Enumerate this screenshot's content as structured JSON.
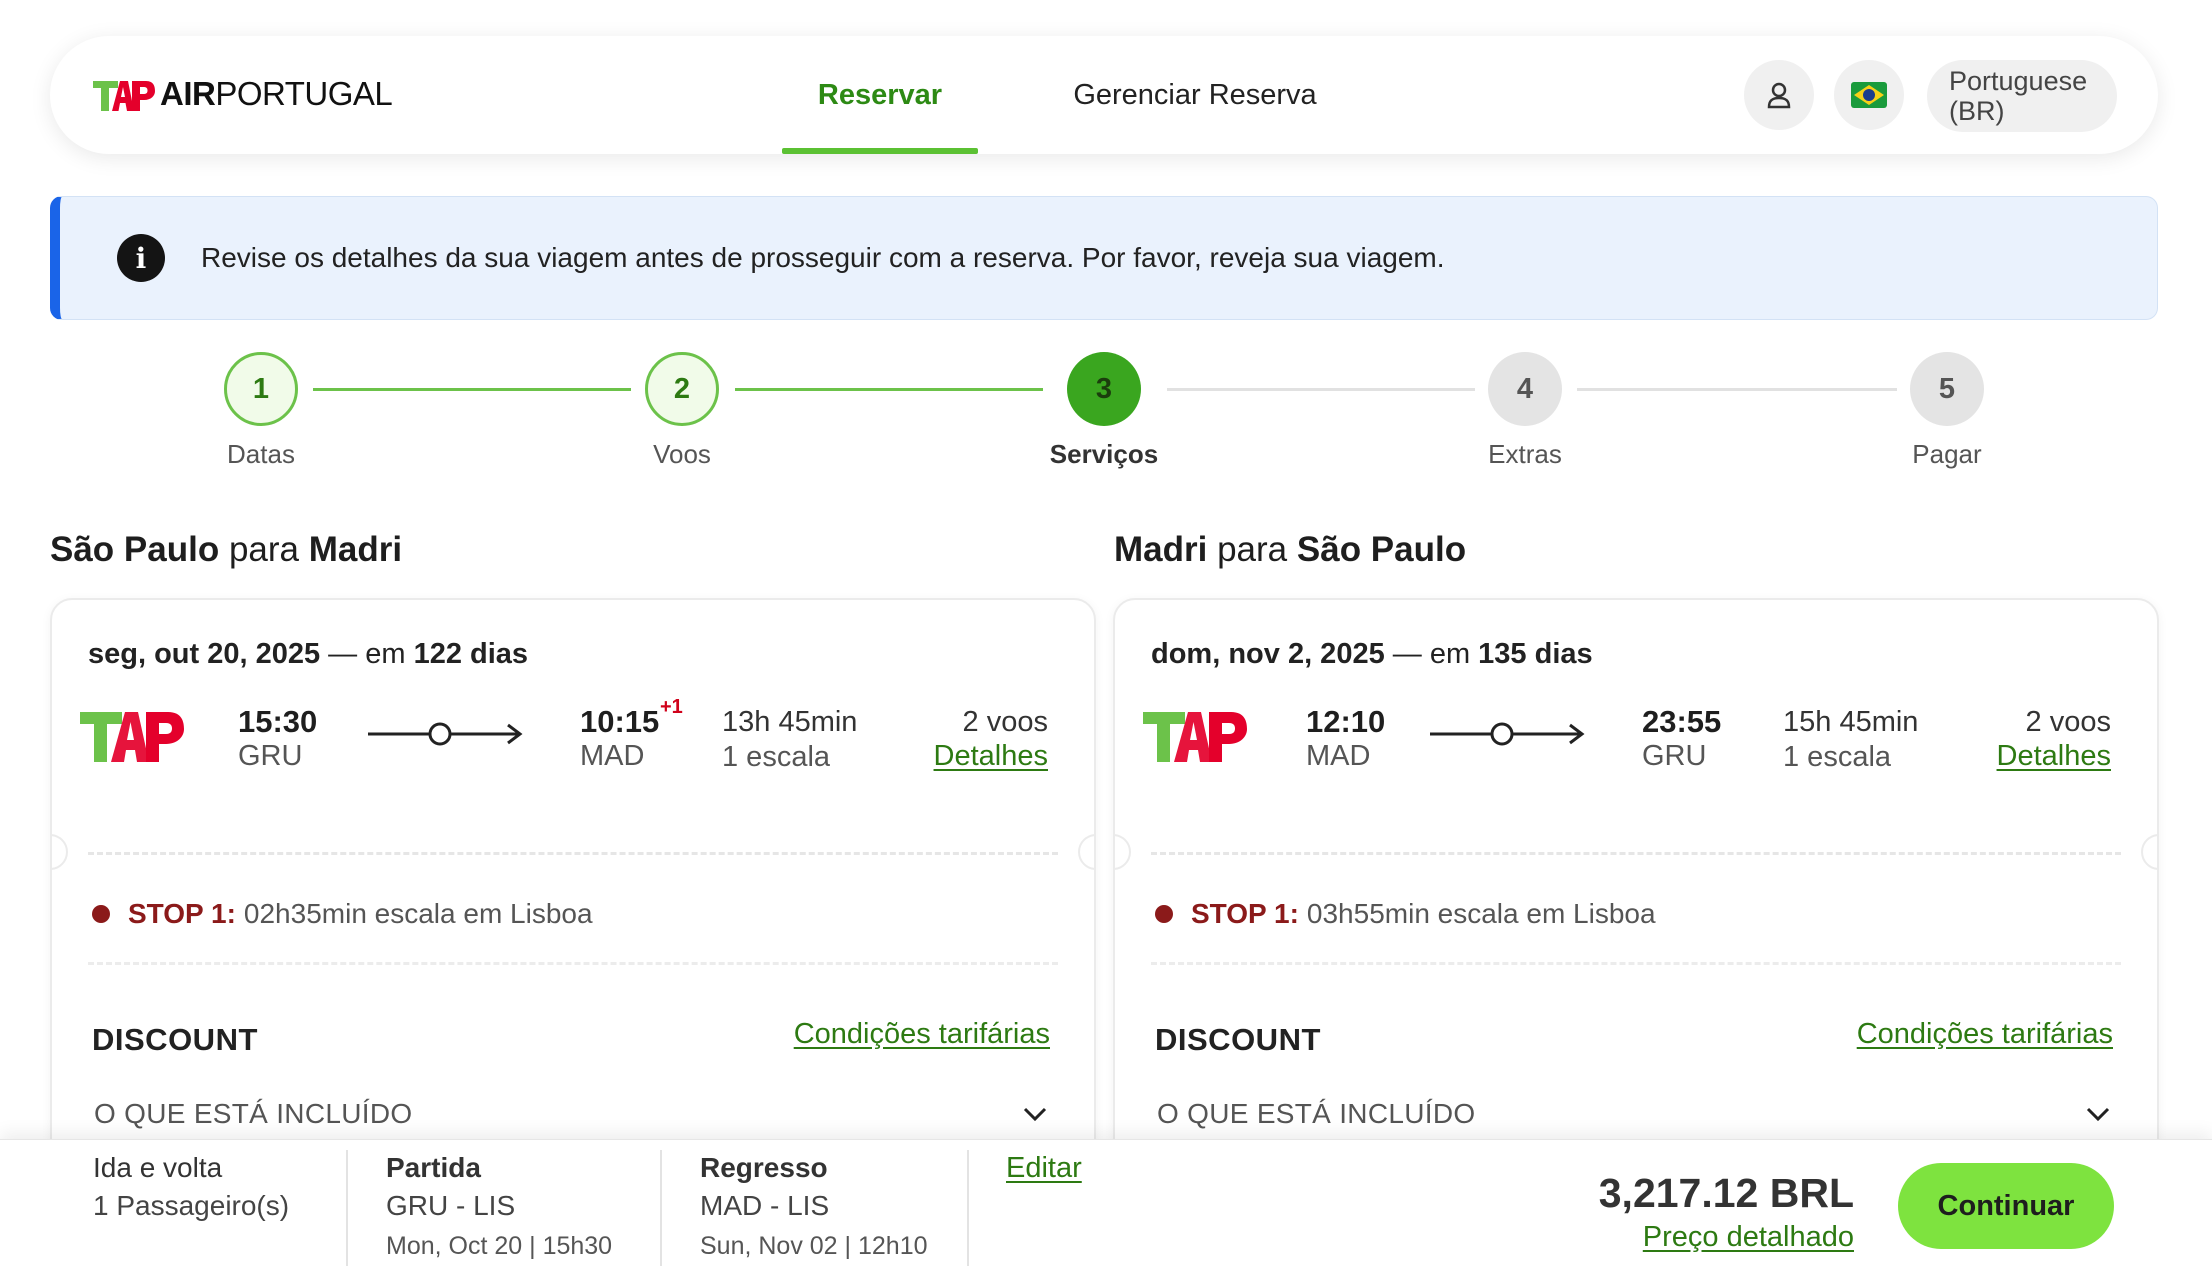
{
  "header": {
    "logo_brand": "TAP",
    "logo_word_bold": "AIR",
    "logo_word": "PORTUGAL",
    "tabs": [
      {
        "label": "Reservar",
        "active": true
      },
      {
        "label": "Gerenciar Reserva",
        "active": false
      }
    ],
    "icons": [
      "user-icon",
      "brazil-flag-icon"
    ],
    "language_label": "Portuguese (BR)"
  },
  "banner": {
    "icon": "info-icon",
    "text": "Revise os detalhes da sua viagem antes de prosseguir com a reserva. Por favor, reveja sua viagem."
  },
  "stepper": {
    "steps": [
      {
        "number": "1",
        "label": "Datas",
        "state": "done"
      },
      {
        "number": "2",
        "label": "Voos",
        "state": "done"
      },
      {
        "number": "3",
        "label": "Serviços",
        "state": "current"
      },
      {
        "number": "4",
        "label": "Extras",
        "state": "todo"
      },
      {
        "number": "5",
        "label": "Pagar",
        "state": "todo"
      }
    ]
  },
  "outbound": {
    "title_from": "São Paulo",
    "title_connector": "para",
    "title_to": "Madri",
    "date": "seg, out 20, 2025",
    "date_separator": " — em ",
    "days_until": "122 dias",
    "depart_time": "15:30",
    "depart_code": "GRU",
    "arrive_time": "10:15",
    "arrive_day_offset": "+1",
    "arrive_code": "MAD",
    "duration": "13h 45min",
    "stops": "1 escala",
    "flights_count": "2 voos",
    "details_link": "Detalhes",
    "stop_label": "STOP 1:",
    "stop_text": "02h35min escala em Lisboa",
    "fare_name": "DISCOUNT",
    "fare_link": "Condições tarifárias",
    "included_label": "O QUE ESTÁ INCLUÍDO"
  },
  "inbound": {
    "title_from": "Madri",
    "title_connector": "para",
    "title_to": "São Paulo",
    "date": "dom, nov 2, 2025",
    "date_separator": " — em ",
    "days_until": "135 dias",
    "depart_time": "12:10",
    "depart_code": "MAD",
    "arrive_time": "23:55",
    "arrive_day_offset": "",
    "arrive_code": "GRU",
    "duration": "15h 45min",
    "stops": "1 escala",
    "flights_count": "2 voos",
    "details_link": "Detalhes",
    "stop_label": "STOP 1:",
    "stop_text": "03h55min escala em Lisboa",
    "fare_name": "DISCOUNT",
    "fare_link": "Condições tarifárias",
    "included_label": "O QUE ESTÁ INCLUÍDO"
  },
  "summary": {
    "trip_type": "Ida e volta",
    "passengers": "1 Passageiro(s)",
    "departure_title": "Partida",
    "departure_route": "GRU - LIS",
    "departure_date": "Mon, Oct 20",
    "departure_time": "15h30",
    "return_title": "Regresso",
    "return_route": "MAD - LIS",
    "return_date": "Sun, Nov 02",
    "return_time": "12h10",
    "edit_link": "Editar",
    "total_price": "3,217.12 BRL",
    "price_detail_link": "Preço detalhado",
    "continue_label": "Continuar"
  },
  "colors": {
    "brand_green": "#7ee33f",
    "link_green": "#2d7a12",
    "tap_red": "#e4002b",
    "stop_red": "#8b1a1a",
    "info_blue": "#1a64e8"
  }
}
